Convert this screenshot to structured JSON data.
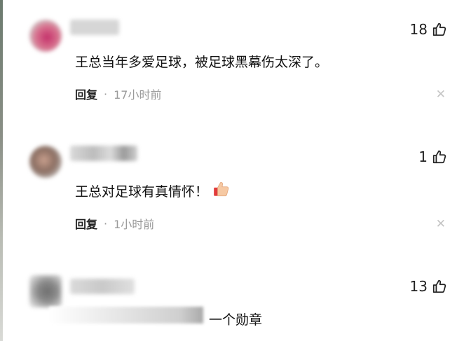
{
  "comments": [
    {
      "likes": "18",
      "text": "王总当年多爱足球，被足球黑幕伤太深了。",
      "reply_label": "回复",
      "separator": "·",
      "time": "17小时前",
      "close_symbol": "✕",
      "avatar_color": "#c4306a"
    },
    {
      "likes": "1",
      "text": "王总对足球有真情怀！",
      "reply_label": "回复",
      "separator": "·",
      "time": "1小时前",
      "close_symbol": "✕",
      "avatar_color": "#8b6e62",
      "emoji": "thumbs-up-emoji"
    },
    {
      "likes": "13",
      "text": "一个勋章",
      "avatar_color": "#7a7a7a"
    }
  ]
}
